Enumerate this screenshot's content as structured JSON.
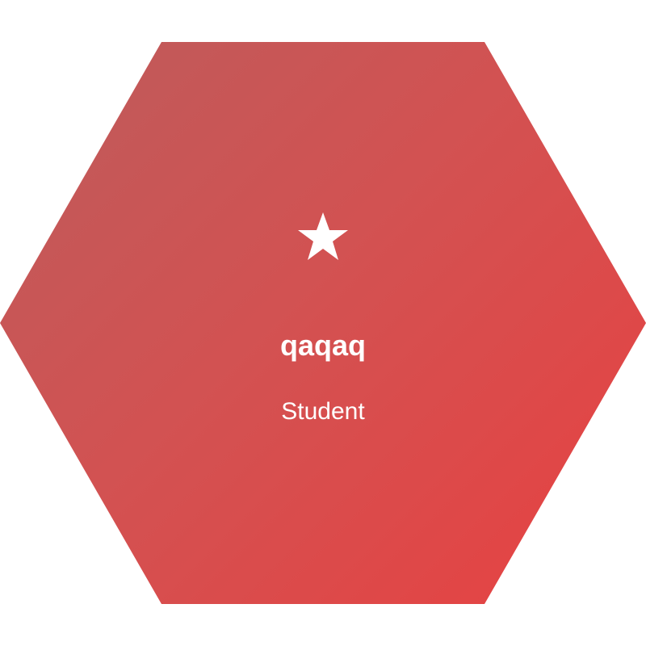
{
  "card": {
    "shape": "hexagon",
    "gradient": {
      "from": "#bb5c5c",
      "to": "#e94040"
    },
    "icon": "star-icon",
    "name": "qaqaq",
    "role": "Student",
    "text_color": "#ffffff"
  }
}
